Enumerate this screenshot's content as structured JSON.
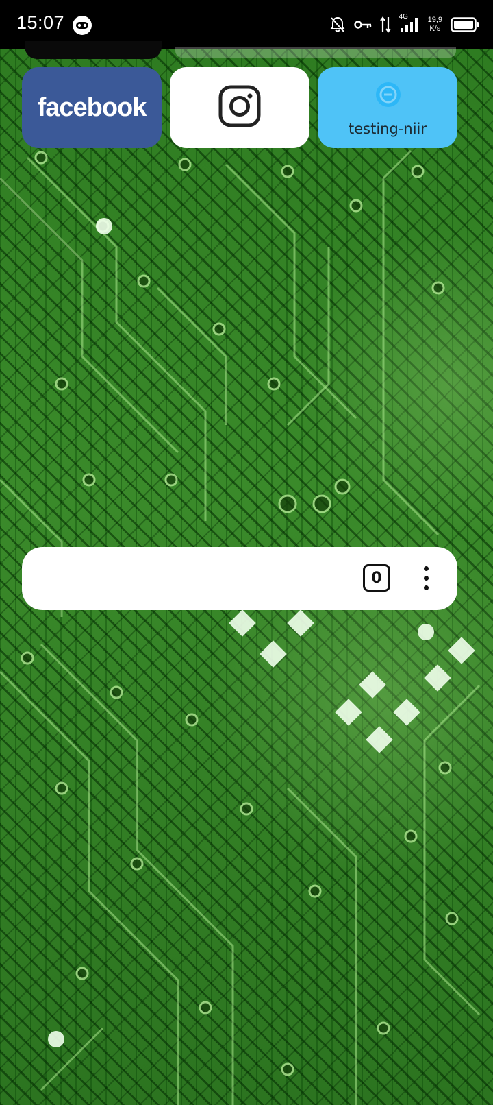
{
  "status_bar": {
    "time": "15:07",
    "network_type": "4G",
    "speed_value": "19,9",
    "speed_unit": "K/s",
    "icons": [
      "game-controller-icon",
      "bell-off-icon",
      "vpn-key-icon",
      "data-arrows-icon",
      "signal-icon",
      "battery-icon"
    ]
  },
  "shortcuts": [
    {
      "label": "facebook",
      "icon": "facebook-logo",
      "color": "#3b5998"
    },
    {
      "label": "",
      "icon": "instagram-icon",
      "color": "#ffffff"
    },
    {
      "label": "testing-niir",
      "icon": "app-logo-icon",
      "color": "#4fc3f7"
    }
  ],
  "search_widget": {
    "tab_count": "0",
    "menu_icon": "more-vertical-icon"
  },
  "colors": {
    "wallpaper": "#2f7d22",
    "facebook": "#3b5998",
    "testing_tile": "#4fc3f7"
  }
}
